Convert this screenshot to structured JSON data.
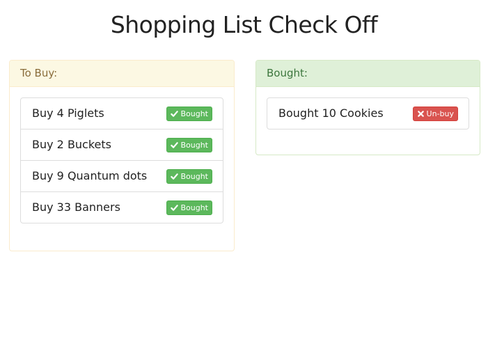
{
  "title": "Shopping List Check Off",
  "to_buy": {
    "heading": "To Buy:",
    "items": [
      {
        "text": "Buy 4 Piglets",
        "button_label": "Bought"
      },
      {
        "text": "Buy 2 Buckets",
        "button_label": "Bought"
      },
      {
        "text": "Buy 9 Quantum dots",
        "button_label": "Bought"
      },
      {
        "text": "Buy 33 Banners",
        "button_label": "Bought"
      }
    ]
  },
  "bought": {
    "heading": "Bought:",
    "items": [
      {
        "text": "Bought 10 Cookies",
        "button_label": "Un-buy"
      }
    ]
  },
  "icons": {
    "bought_button": "check-icon",
    "unbuy_button": "close-icon"
  },
  "colors": {
    "to_buy_heading_bg": "#fcf8e3",
    "to_buy_heading_text": "#8a6d3b",
    "bought_heading_bg": "#dff0d8",
    "bought_heading_text": "#3c763d",
    "success_button": "#5cb85c",
    "danger_button": "#d9534f"
  }
}
